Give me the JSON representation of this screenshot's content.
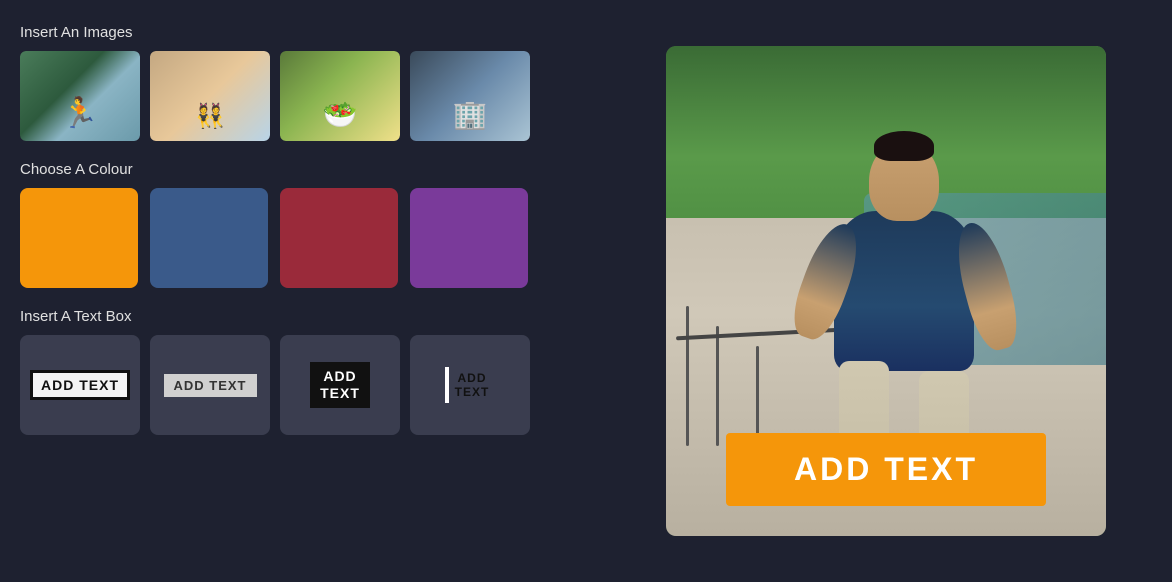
{
  "sections": {
    "images": {
      "title": "Insert An Images",
      "items": [
        {
          "id": "img-runner",
          "label": "Runner image",
          "css_class": "img-1"
        },
        {
          "id": "img-group",
          "label": "Group jumping image",
          "css_class": "img-2"
        },
        {
          "id": "img-salad",
          "label": "Salad image",
          "css_class": "img-3"
        },
        {
          "id": "img-building",
          "label": "Building image",
          "css_class": "img-4"
        }
      ]
    },
    "colours": {
      "title": "Choose A Colour",
      "items": [
        {
          "id": "orange",
          "hex": "#f5960a",
          "label": "Orange"
        },
        {
          "id": "blue",
          "hex": "#3a5a8a",
          "label": "Blue"
        },
        {
          "id": "red",
          "hex": "#9a2a3a",
          "label": "Red"
        },
        {
          "id": "purple",
          "hex": "#7a3a9a",
          "label": "Purple"
        }
      ]
    },
    "textboxes": {
      "title": "Insert A Text Box",
      "items": [
        {
          "id": "tb1",
          "label": "ADD TEXT",
          "style": "tb-style-1",
          "desc": "White box bold border"
        },
        {
          "id": "tb2",
          "label": "ADD TEXT",
          "style": "tb-style-2",
          "desc": "Gray background"
        },
        {
          "id": "tb3",
          "label": "ADD\nTEXT",
          "style": "tb-style-3",
          "desc": "Black background white text"
        },
        {
          "id": "tb4",
          "label": "ADD\nTEXT",
          "style": "tb-style-4",
          "desc": "Left border accent"
        }
      ]
    }
  },
  "preview": {
    "overlay_text": "ADD TEXT",
    "alt": "Preview canvas with runner image and orange text overlay"
  }
}
